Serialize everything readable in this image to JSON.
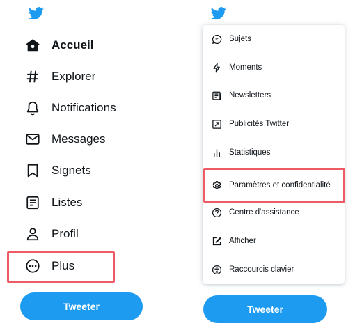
{
  "colors": {
    "brand": "#1d9bf0",
    "highlight": "#ef5b64",
    "text": "#0f1419"
  },
  "left_panel": {
    "logo_icon": "twitter-bird-icon",
    "nav": [
      {
        "label": "Accueil",
        "icon": "home-icon"
      },
      {
        "label": "Explorer",
        "icon": "hashtag-icon"
      },
      {
        "label": "Notifications",
        "icon": "bell-icon"
      },
      {
        "label": "Messages",
        "icon": "envelope-icon"
      },
      {
        "label": "Signets",
        "icon": "bookmark-icon"
      },
      {
        "label": "Listes",
        "icon": "list-icon"
      },
      {
        "label": "Profil",
        "icon": "person-icon"
      },
      {
        "label": "Plus",
        "icon": "more-circle-icon"
      }
    ],
    "tweet_button": "Tweeter"
  },
  "right_panel": {
    "logo_icon": "twitter-bird-icon",
    "menu": [
      {
        "label": "Sujets",
        "icon": "topics-icon"
      },
      {
        "label": "Moments",
        "icon": "lightning-icon"
      },
      {
        "label": "Newsletters",
        "icon": "newsletter-icon"
      },
      {
        "label": "Publicités Twitter",
        "icon": "external-arrow-icon"
      },
      {
        "label": "Statistiques",
        "icon": "bar-chart-icon"
      },
      {
        "label": "Paramètres et confidentialité",
        "icon": "gear-icon"
      },
      {
        "label": "Centre d'assistance",
        "icon": "help-icon"
      },
      {
        "label": "Afficher",
        "icon": "edit-display-icon"
      },
      {
        "label": "Raccourcis clavier",
        "icon": "accessibility-icon"
      }
    ],
    "tweet_button": "Tweeter"
  }
}
